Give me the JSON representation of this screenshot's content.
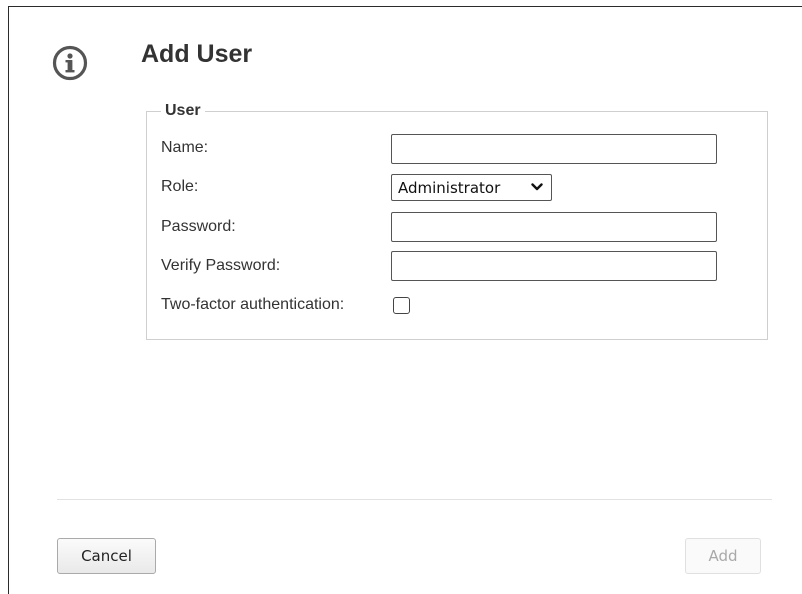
{
  "dialog": {
    "title": "Add User",
    "icon": "info-icon"
  },
  "user_group": {
    "legend": "User",
    "fields": {
      "name": {
        "label": "Name:",
        "value": ""
      },
      "role": {
        "label": "Role:",
        "selected": "Administrator"
      },
      "password": {
        "label": "Password:",
        "value": ""
      },
      "verify_password": {
        "label": "Verify Password:",
        "value": ""
      },
      "two_factor": {
        "label": "Two-factor authentication:",
        "checked": false
      }
    }
  },
  "footer": {
    "cancel_label": "Cancel",
    "add_label": "Add"
  }
}
